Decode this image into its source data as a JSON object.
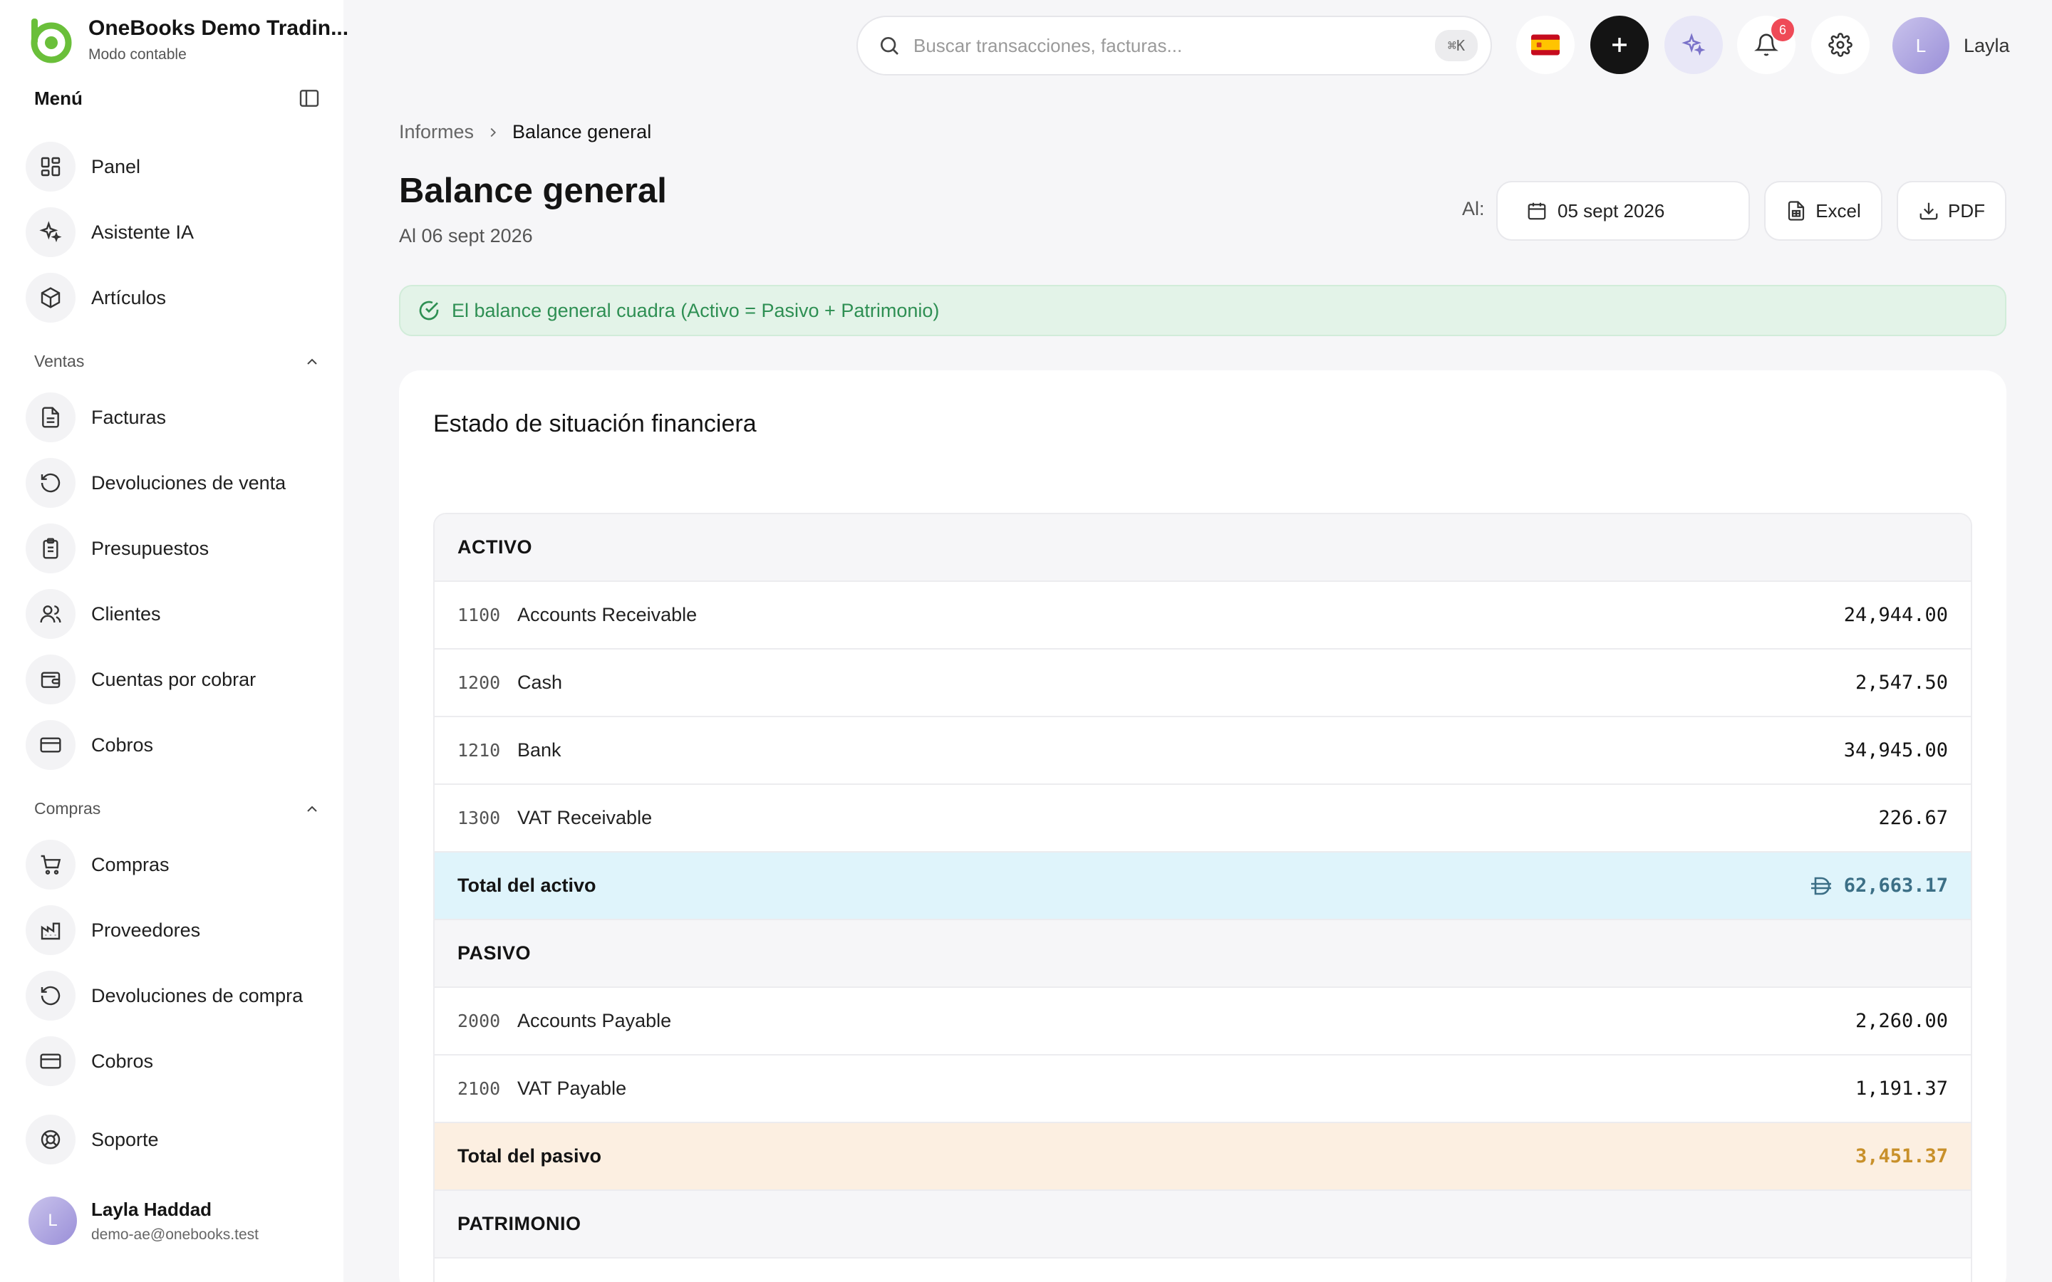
{
  "brand": {
    "name": "OneBooks Demo Tradin...",
    "mode": "Modo contable",
    "accent": "#6abf3a"
  },
  "sidebar": {
    "menu_title": "Menú",
    "items_main": [
      {
        "label": "Panel",
        "icon": "dashboard-icon"
      },
      {
        "label": "Asistente IA",
        "icon": "sparkles-icon"
      },
      {
        "label": "Artículos",
        "icon": "package-icon"
      }
    ],
    "sections": [
      {
        "title": "Ventas",
        "items": [
          {
            "label": "Facturas",
            "icon": "document-icon"
          },
          {
            "label": "Devoluciones de venta",
            "icon": "undo-icon"
          },
          {
            "label": "Presupuestos",
            "icon": "clipboard-icon"
          },
          {
            "label": "Clientes",
            "icon": "users-icon"
          },
          {
            "label": "Cuentas por cobrar",
            "icon": "wallet-icon"
          },
          {
            "label": "Cobros",
            "icon": "credit-card-icon"
          }
        ]
      },
      {
        "title": "Compras",
        "items": [
          {
            "label": "Compras",
            "icon": "cart-icon"
          },
          {
            "label": "Proveedores",
            "icon": "factory-icon"
          },
          {
            "label": "Devoluciones de compra",
            "icon": "undo-icon"
          },
          {
            "label": "Cobros",
            "icon": "credit-card-icon"
          }
        ]
      }
    ],
    "support": {
      "label": "Soporte",
      "icon": "lifebuoy-icon"
    },
    "user": {
      "initial": "L",
      "name": "Layla Haddad",
      "email": "demo-ae@onebooks.test"
    }
  },
  "topbar": {
    "search_placeholder": "Buscar transacciones, facturas...",
    "shortcut": "⌘K",
    "notifications_count": "6",
    "user_initial": "L",
    "user_name": "Layla"
  },
  "page": {
    "breadcrumb": [
      "Informes",
      "Balance general"
    ],
    "title": "Balance general",
    "subtitle": "Al 06 sept 2026",
    "as_of_label": "Al:",
    "date_value": "05 sept 2026",
    "excel_label": "Excel",
    "pdf_label": "PDF",
    "balance_message": "El balance general cuadra (Activo = Pasivo + Patrimonio)"
  },
  "report": {
    "title": "Estado de situación financiera",
    "assets": {
      "heading": "ACTIVO",
      "rows": [
        {
          "code": "1100",
          "name": "Accounts Receivable",
          "amount": "24,944.00"
        },
        {
          "code": "1200",
          "name": "Cash",
          "amount": "2,547.50"
        },
        {
          "code": "1210",
          "name": "Bank",
          "amount": "34,945.00"
        },
        {
          "code": "1300",
          "name": "VAT Receivable",
          "amount": "226.67"
        }
      ],
      "total_label": "Total del activo",
      "total_amount": "62,663.17"
    },
    "liabilities": {
      "heading": "PASIVO",
      "rows": [
        {
          "code": "2000",
          "name": "Accounts Payable",
          "amount": "2,260.00"
        },
        {
          "code": "2100",
          "name": "VAT Payable",
          "amount": "1,191.37"
        }
      ],
      "total_label": "Total del pasivo",
      "total_amount": "3,451.37"
    },
    "equity": {
      "heading": "PATRIMONIO"
    }
  }
}
